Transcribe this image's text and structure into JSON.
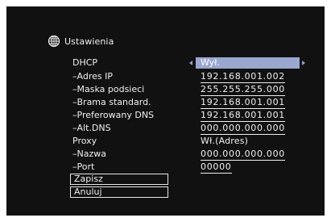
{
  "header": {
    "title": "Ustawienia",
    "icon": "globe-icon"
  },
  "settings": {
    "dhcp": {
      "label": "DHCP",
      "value": "Wył."
    },
    "ip": {
      "label": "–Adres IP",
      "value": "192.168.001.002"
    },
    "mask": {
      "label": "–Maska podsieci",
      "value": "255.255.255.000"
    },
    "gateway": {
      "label": "–Brama standard.",
      "value": "192.168.001.001"
    },
    "dns1": {
      "label": "–Preferowany DNS",
      "value": "192.168.001.001"
    },
    "dns2": {
      "label": "–Alt.DNS",
      "value": "000.000.000.000"
    },
    "proxy": {
      "label": "Proxy",
      "value": "Wł.(Adres)"
    },
    "proxy_name": {
      "label": "–Nazwa",
      "value": "000.000.000.000"
    },
    "proxy_port": {
      "label": "–Port",
      "value": "00000"
    }
  },
  "buttons": {
    "save": "Zapisz",
    "cancel": "Anuluj"
  },
  "colors": {
    "background": "#111111",
    "text": "#f0f0f0",
    "highlight": "#9aa7cf"
  }
}
